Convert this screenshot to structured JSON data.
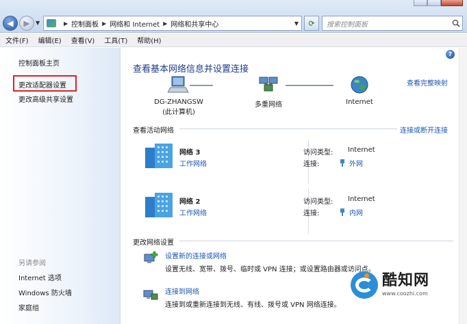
{
  "nav": {
    "breadcrumbs": [
      "控制面板",
      "网络和 Internet",
      "网络和共享中心"
    ],
    "search_placeholder": "搜索控制面板"
  },
  "menu": [
    "文件(F)",
    "编辑(E)",
    "查看(V)",
    "工具(T)",
    "帮助(H)"
  ],
  "sidebar": {
    "home": "控制面板主页",
    "links": [
      "更改适配器设置",
      "更改高级共享设置"
    ],
    "see_also_title": "另请参阅",
    "see_also": [
      "Internet 选项",
      "Windows 防火墙",
      "家庭组"
    ]
  },
  "main": {
    "title": "查看基本网络信息并设置连接",
    "full_map_link": "查看完整映射",
    "nodes": [
      {
        "line1": "DG-ZHANGSW",
        "line2": "(此计算机)",
        "icon": "computer-icon"
      },
      {
        "line1": "多重网络",
        "line2": "",
        "icon": "multiple-networks-icon"
      },
      {
        "line1": "Internet",
        "line2": "",
        "icon": "globe-icon"
      }
    ],
    "active_label": "查看活动网络",
    "connect_link": "连接或断开连接",
    "networks": [
      {
        "name": "网络  3",
        "type": "工作网络",
        "access_label": "访问类型:",
        "access_value": "Internet",
        "conn_label": "连接:",
        "conn_value": "外网"
      },
      {
        "name": "网络  2",
        "type": "工作网络",
        "access_label": "访问类型:",
        "access_value": "Internet",
        "conn_label": "连接:",
        "conn_value": "内网"
      }
    ],
    "settings_label": "更改网络设置",
    "tasks": [
      {
        "link": "设置新的连接或网络",
        "desc": "设置无线、宽带、拨号、临时或 VPN 连接；或设置路由器或访问点。"
      },
      {
        "link": "连接到网络",
        "desc": "连接到或重新连接到无线、有线、拨号或 VPN 网络连接。"
      }
    ]
  },
  "watermark": {
    "title": "酷知网",
    "url": "www.coozhi.com"
  },
  "colors": {
    "link": "#1a56b6",
    "title": "#1e3b8a",
    "highlight": "#d8232a"
  }
}
